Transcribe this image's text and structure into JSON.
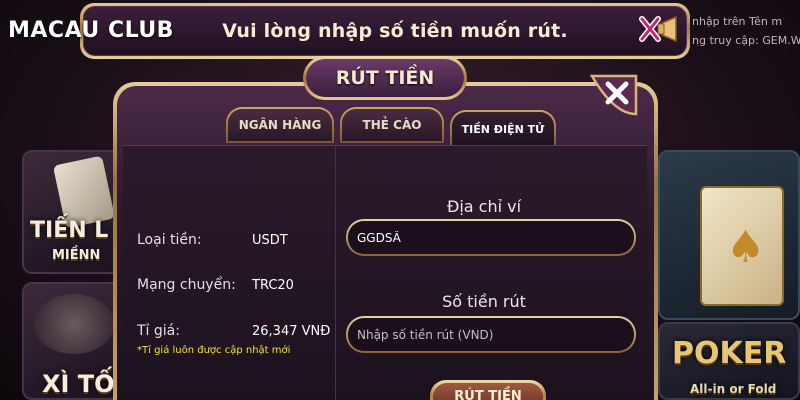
{
  "brand": {
    "logo_text": "MACAU CLUB"
  },
  "banner": {
    "message": "Vui lòng nhập số tiền muốn rút."
  },
  "background_notice": {
    "line1": "nhập trên Tên m",
    "line2": "ng truy cập: GEM.W"
  },
  "background_tiles": {
    "left_1": "TIẾN L",
    "left_1_sub": "MIỀNN",
    "left_2": "XÌ TỐ",
    "right_2": "POKER",
    "right_2_sub": "All-in or Fold"
  },
  "dialog": {
    "title": "RÚT TIỀN",
    "tabs": [
      {
        "label": "NGÂN HÀNG"
      },
      {
        "label": "THẺ CÀO"
      },
      {
        "label": "TIỀN ĐIỆN TỬ",
        "active": true
      }
    ],
    "info": {
      "currency_label": "Loại tiền:",
      "currency_value": "USDT",
      "network_label": "Mạng chuyển:",
      "network_value": "TRC20",
      "rate_label": "Tỉ giá:",
      "rate_value": "26,347 VNĐ",
      "rate_note": "*Tỉ giá luôn được cập nhật mới"
    },
    "form": {
      "wallet_heading": "Địa chỉ ví",
      "wallet_value": "GGDSÂ",
      "amount_heading": "Số tiền rút",
      "amount_placeholder": "Nhập số tiền rút (VND)",
      "amount_value": "",
      "submit_label": "RÚT TIỀN"
    }
  },
  "colors": {
    "gold": "#c9a468",
    "panel": "#2b1a2b",
    "note_yellow": "#f2e13a"
  },
  "icons": {
    "banner_close": "x-megaphone-icon",
    "dialog_close": "close-icon"
  }
}
